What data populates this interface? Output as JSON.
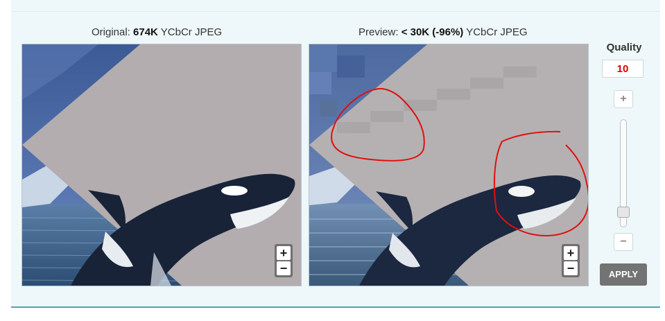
{
  "original": {
    "label_prefix": "Original: ",
    "size": "674K",
    "format": " YCbCr JPEG",
    "zoom_in": "+",
    "zoom_out": "−"
  },
  "preview": {
    "label_prefix": "Preview: ",
    "size": "< 30K (-96%)",
    "format": " YCbCr JPEG",
    "zoom_in": "+",
    "zoom_out": "−"
  },
  "quality": {
    "label": "Quality",
    "value": "10",
    "increment": "+",
    "decrement": "−",
    "slider_level": 0.1
  },
  "apply_label": "APPLY",
  "colors": {
    "panel_bg": "#eef7f9",
    "accent_line": "#4fa3ab",
    "quality_value": "#e00000",
    "apply_bg": "#737373",
    "annotation": "#e01010"
  }
}
